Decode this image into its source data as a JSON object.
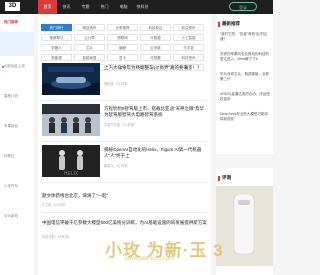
{
  "header": {
    "logo": "3D",
    "nav": [
      "首页",
      "快讯",
      "专题",
      "热门",
      "电脑",
      "快科技"
    ],
    "login": "登录"
  },
  "left": {
    "section_title": "热门推荐",
    "items": [
      "AI新功能上线",
      "星舰计划",
      "苹果新品",
      "特斯拉",
      "小米汽车",
      "华为新机"
    ]
  },
  "tags": [
    [
      "热门排行",
      "精选资讯",
      "头条推荐",
      "科技前沿",
      "前沿资讯"
    ],
    [
      "推荐算法",
      "云计算",
      "物联网",
      "大数据",
      "人工智能"
    ],
    [
      "机器人",
      "芯片",
      "编程",
      "区块链",
      "元宇宙"
    ],
    [
      "新能源",
      "智能家居",
      "显卡",
      "可穿戴",
      "科技快讯"
    ],
    [
      "卫星通信",
      "半导体",
      "游戏",
      "开源",
      "数码"
    ]
  ],
  "articles": [
    {
      "title": "上汽大众今年为终端整车，“尚界”真的要来了！？",
      "meta": "快科技 · 2小时前"
    },
    {
      "title": "方程豹豹8智驾版上市，搭载比亚迪“天神之眼”及华为智驾版智驾大电路智驾系统",
      "meta": "中国汽车报 · 3小时前"
    },
    {
      "title": "揭秘OpenAI自动化的Helix，Figure AI第一代机器人“人”终于上",
      "meta": "新智元 · 5小时前"
    }
  ],
  "plain_list": [
    {
      "title": "题文体新线台北京，滴滴了“一起”",
      "meta": "IT之家 · 6小时前"
    },
    {
      "title": "中国电信突破千亿参数大模型500亿美统分训练，为AI基础设施的同发展提供新方案",
      "meta": "科技日报 · 8小时前"
    }
  ],
  "right": {
    "box1_title": "最新推荐",
    "box1_items": [
      "“我们它的，”抗疫“有效”后不加速？",
      "苏伊的苹果向实业推动的科技的表达进入，Meta解了下6",
      "华为自研芯片，瓶颈被破，全新第二代",
      "ARM与高通达成的合约，涉及授权费用",
      "DeepSeek专业的大模型可能将将新改变"
    ],
    "box2_title": "评测"
  },
  "watermark": {
    "main": "小玫 为新·玉 3",
    "sub": "www.kkk-kids.com"
  }
}
